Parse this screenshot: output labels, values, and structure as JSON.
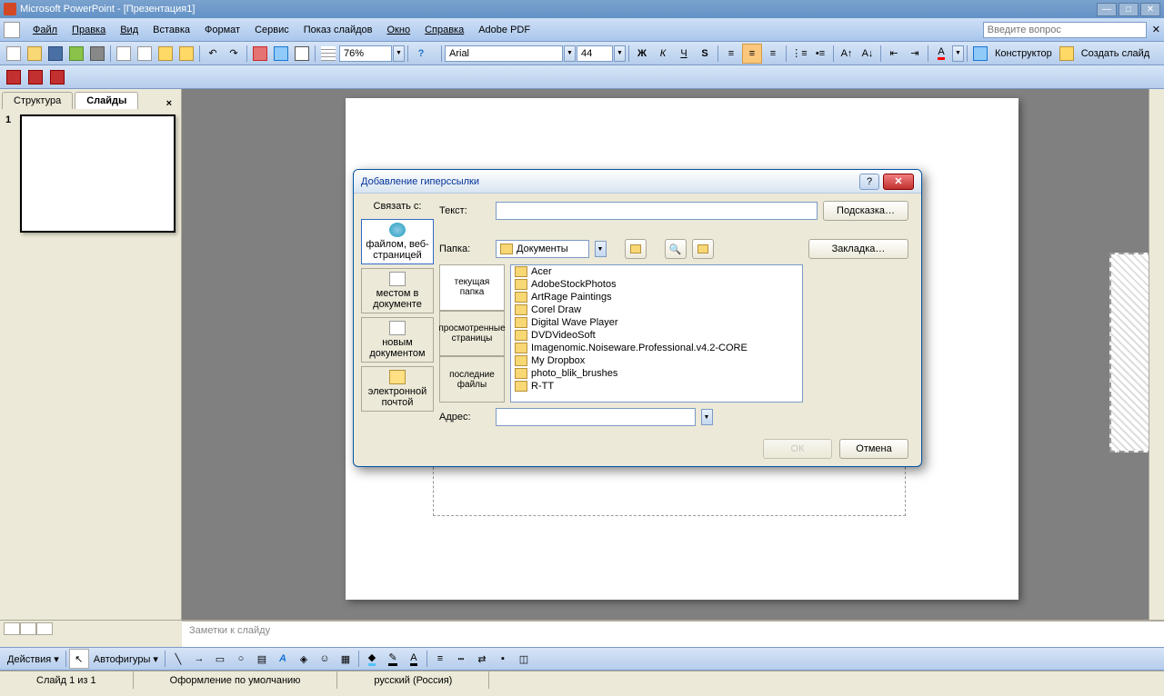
{
  "title": "Microsoft PowerPoint - [Презентация1]",
  "menu": {
    "file": "Файл",
    "edit": "Правка",
    "view": "Вид",
    "insert": "Вставка",
    "format": "Формат",
    "service": "Сервис",
    "slideshow": "Показ слайдов",
    "window": "Окно",
    "help": "Справка",
    "adobe": "Adobe PDF"
  },
  "help_placeholder": "Введите вопрос",
  "toolbar": {
    "zoom": "76%",
    "font": "Arial",
    "size": "44",
    "designer": "Конструктор",
    "new_slide": "Создать слайд"
  },
  "tabs": {
    "structure": "Структура",
    "slides": "Слайды"
  },
  "thumb_num": "1",
  "notes_placeholder": "Заметки к слайду",
  "bottom": {
    "actions": "Действия",
    "autoshapes": "Автофигуры"
  },
  "status": {
    "slide": "Слайд 1 из 1",
    "design": "Оформление по умолчанию",
    "lang": "русский (Россия)"
  },
  "dialog": {
    "title": "Добавление гиперссылки",
    "link_with": "Связать с:",
    "text_label": "Текст:",
    "hint_btn": "Подсказка…",
    "folder_label": "Папка:",
    "folder_value": "Документы",
    "bookmark_btn": "Закладка…",
    "address_label": "Адрес:",
    "ok_btn": "ОК",
    "cancel_btn": "Отмена",
    "link_types": {
      "file_web": "файлом, веб-страницей",
      "place": "местом в документе",
      "new_doc": "новым документом",
      "email": "электронной почтой"
    },
    "browse_tabs": {
      "current": "текущая папка",
      "viewed": "просмотренные страницы",
      "recent": "последние файлы"
    },
    "files": [
      "Acer",
      "AdobeStockPhotos",
      "ArtRage Paintings",
      "Corel Draw",
      "Digital Wave Player",
      "DVDVideoSoft",
      "Imagenomic.Noiseware.Professional.v4.2-CORE",
      "My Dropbox",
      "photo_blik_brushes",
      "R-TT"
    ]
  }
}
